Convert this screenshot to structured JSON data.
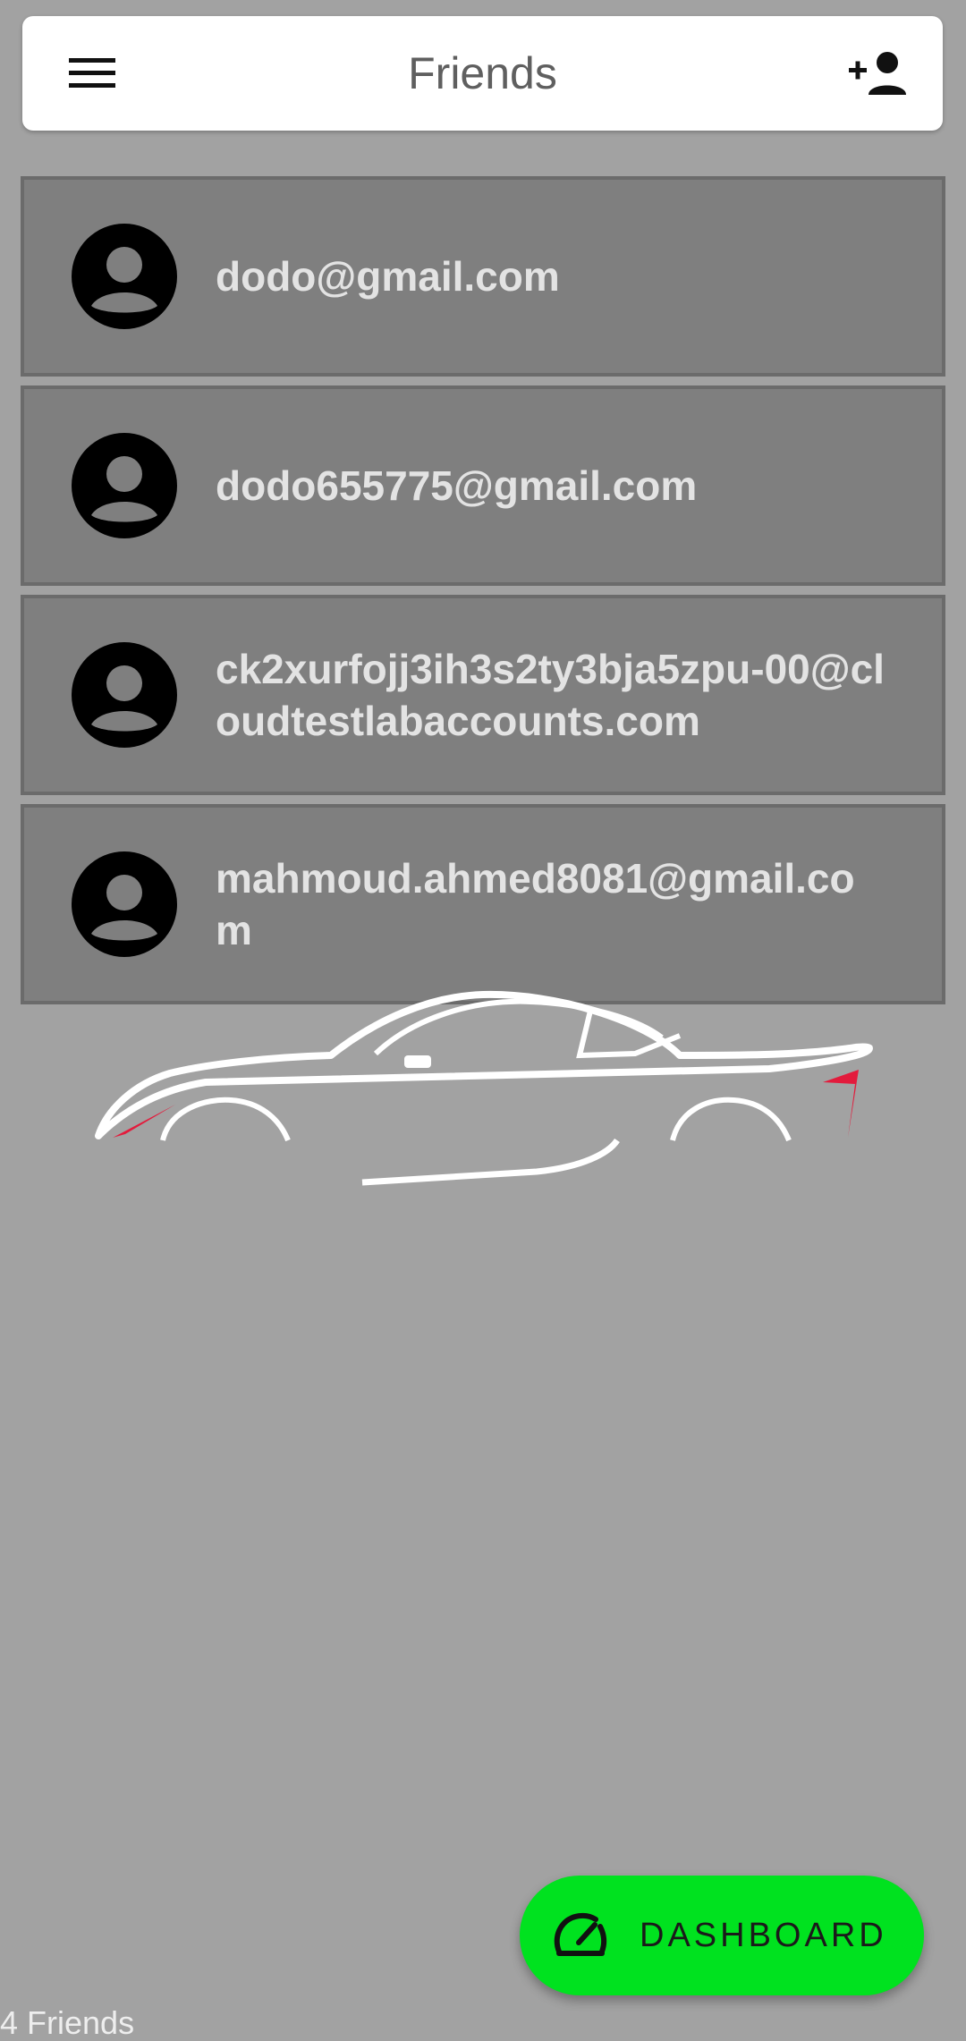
{
  "header": {
    "title": "Friends",
    "menu_icon": "hamburger-menu-icon",
    "add_icon": "add-friend-icon"
  },
  "friends": [
    {
      "email": "dodo@gmail.com",
      "avatar_icon": "account-circle-icon"
    },
    {
      "email": "dodo655775@gmail.com",
      "avatar_icon": "account-circle-icon"
    },
    {
      "email": "ck2xurfojj3ih3s2ty3bja5zpu-00@cloudtestlabaccounts.com",
      "avatar_icon": "account-circle-icon"
    },
    {
      "email": "mahmoud.ahmed8081@gmail.com",
      "avatar_icon": "account-circle-icon"
    }
  ],
  "dashboard_button": {
    "label": "DASHBOARD",
    "icon": "speedometer-icon",
    "color": "#00e21f"
  },
  "footer": {
    "friend_count": "4 Friends"
  },
  "colors": {
    "background": "#a2a2a2",
    "card": "#7f7f7f",
    "accent": "#00e21f"
  }
}
